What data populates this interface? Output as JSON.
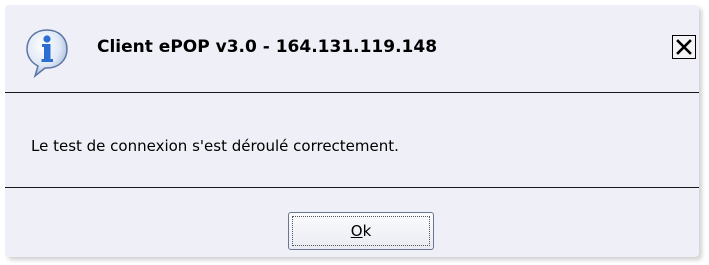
{
  "dialog": {
    "title": "Client ePOP v3.0 - 164.131.119.148",
    "message": "Le test de connexion s'est déroulé correctement.",
    "close_icon": "close-x-icon",
    "info_icon": "info-speech-bubble-icon",
    "ok_button": {
      "mnemonic": "O",
      "rest": "k"
    }
  },
  "colors": {
    "dialog_background": "#eff0f7",
    "icon_blue": "#2a6fd1",
    "divider": "#1a1a1a"
  }
}
